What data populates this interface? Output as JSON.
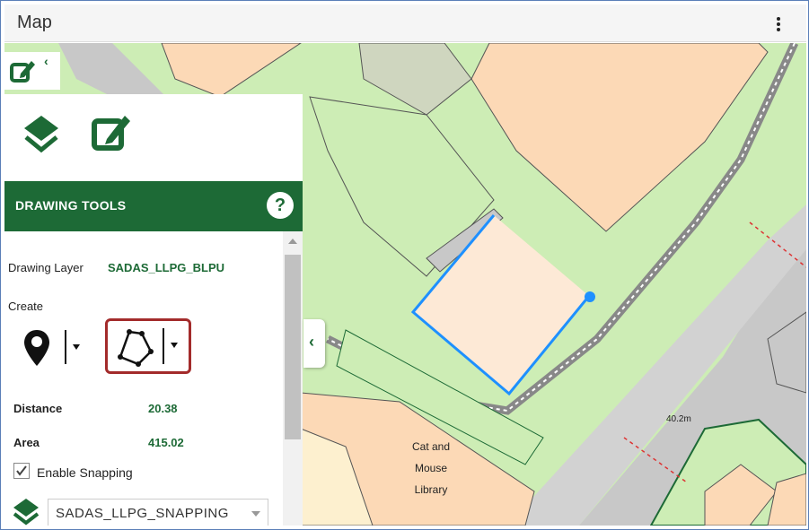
{
  "window": {
    "title": "Map",
    "menu_icon": "kebab-menu-icon"
  },
  "panel": {
    "icons": [
      "layers-icon",
      "edit-icon"
    ],
    "header": "DRAWING TOOLS",
    "help_label": "?",
    "drawing_layer_label": "Drawing Layer",
    "drawing_layer_value": "SADAS_LLPG_BLPU",
    "create_label": "Create",
    "tools": [
      "point-marker-icon",
      "polygon-icon"
    ],
    "distance_label": "Distance",
    "distance_value": "20.38",
    "area_label": "Area",
    "area_value": "415.02",
    "snapping_label": "Enable Snapping",
    "snapping_checked": true,
    "snap_layer_value": "SADAS_LLPG_SNAPPING"
  },
  "map": {
    "building_label_lines": [
      "Cat and",
      "Mouse",
      "Library"
    ],
    "height_label": "40.2m"
  },
  "colors": {
    "brand_green": "#1d6a36",
    "map_green": "#cdedb5",
    "map_building": "#fcd9b6",
    "map_gray": "#c8c8c8",
    "draw_blue": "#1e90ff",
    "active_tool_border": "#a32b2b"
  }
}
